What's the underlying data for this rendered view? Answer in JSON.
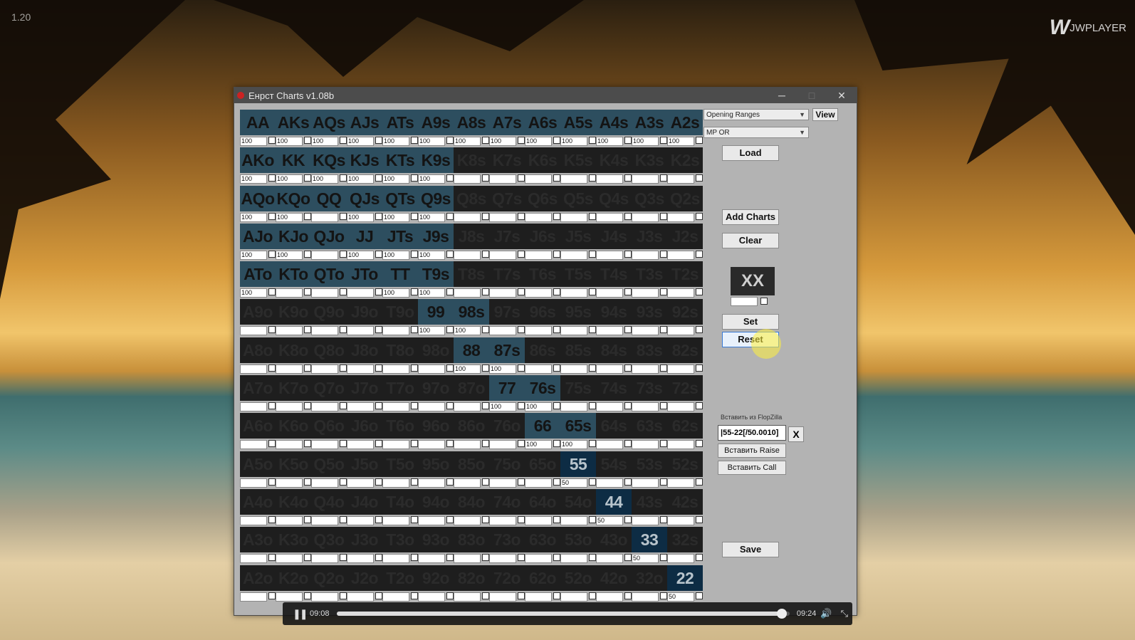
{
  "video": {
    "top_time": "1.20",
    "logo": "JWPLAYER",
    "current_time": "09:08",
    "duration": "09:24",
    "progress": 0.983
  },
  "window": {
    "title": "Енрст Charts v1.08b",
    "min": "─",
    "max": "□",
    "close": "✕"
  },
  "grid": {
    "rows": [
      [
        "AA",
        "AKs",
        "AQs",
        "AJs",
        "ATs",
        "A9s",
        "A8s",
        "A7s",
        "A6s",
        "A5s",
        "A4s",
        "A3s",
        "A2s"
      ],
      [
        "AKo",
        "KK",
        "KQs",
        "KJs",
        "KTs",
        "K9s",
        "K8s",
        "K7s",
        "K6s",
        "K5s",
        "K4s",
        "K3s",
        "K2s"
      ],
      [
        "AQo",
        "KQo",
        "QQ",
        "QJs",
        "QTs",
        "Q9s",
        "Q8s",
        "Q7s",
        "Q6s",
        "Q5s",
        "Q4s",
        "Q3s",
        "Q2s"
      ],
      [
        "AJo",
        "KJo",
        "QJo",
        "JJ",
        "JTs",
        "J9s",
        "J8s",
        "J7s",
        "J6s",
        "J5s",
        "J4s",
        "J3s",
        "J2s"
      ],
      [
        "ATo",
        "KTo",
        "QTo",
        "JTo",
        "TT",
        "T9s",
        "T8s",
        "T7s",
        "T6s",
        "T5s",
        "T4s",
        "T3s",
        "T2s"
      ],
      [
        "A9o",
        "K9o",
        "Q9o",
        "J9o",
        "T9o",
        "99",
        "98s",
        "97s",
        "96s",
        "95s",
        "94s",
        "93s",
        "92s"
      ],
      [
        "A8o",
        "K8o",
        "Q8o",
        "J8o",
        "T8o",
        "98o",
        "88",
        "87s",
        "86s",
        "85s",
        "84s",
        "83s",
        "82s"
      ],
      [
        "A7o",
        "K7o",
        "Q7o",
        "J7o",
        "T7o",
        "97o",
        "87o",
        "77",
        "76s",
        "75s",
        "74s",
        "73s",
        "72s"
      ],
      [
        "A6o",
        "K6o",
        "Q6o",
        "J6o",
        "T6o",
        "96o",
        "86o",
        "76o",
        "66",
        "65s",
        "64s",
        "63s",
        "62s"
      ],
      [
        "A5o",
        "K5o",
        "Q5o",
        "J5o",
        "T5o",
        "95o",
        "85o",
        "75o",
        "65o",
        "55",
        "54s",
        "53s",
        "52s"
      ],
      [
        "A4o",
        "K4o",
        "Q4o",
        "J4o",
        "T4o",
        "94o",
        "84o",
        "74o",
        "64o",
        "54o",
        "44",
        "43s",
        "42s"
      ],
      [
        "A3o",
        "K3o",
        "Q3o",
        "J3o",
        "T3o",
        "93o",
        "83o",
        "73o",
        "63o",
        "53o",
        "43o",
        "33",
        "32s"
      ],
      [
        "A2o",
        "K2o",
        "Q2o",
        "J2o",
        "T2o",
        "92o",
        "82o",
        "72o",
        "62o",
        "52o",
        "42o",
        "32o",
        "22"
      ]
    ],
    "percents": {
      "AA": "100",
      "AKs": "100",
      "AQs": "100",
      "AJs": "100",
      "ATs": "100",
      "A9s": "100",
      "A8s": "100",
      "A7s": "100",
      "A6s": "100",
      "A5s": "100",
      "A4s": "100",
      "A3s": "100",
      "A2s": "100",
      "AKo": "100",
      "KK": "100",
      "KQs": "100",
      "KJs": "100",
      "KTs": "100",
      "K9s": "100",
      "AQo": "100",
      "KQo": "100",
      "QJs": "100",
      "QTs": "100",
      "Q9s": "100",
      "AJo": "100",
      "KJo": "100",
      "JJ": "100",
      "JTs": "100",
      "J9s": "100",
      "ATo": "100",
      "TT": "100",
      "T9s": "100",
      "99": "100",
      "98s": "100",
      "88": "100",
      "87s": "100",
      "77": "100",
      "76s": "100",
      "66": "100",
      "65s": "100",
      "55": "50",
      "44": "50",
      "33": "50",
      "22": "50"
    },
    "selected": [
      "AA",
      "AKs",
      "AQs",
      "AJs",
      "ATs",
      "A9s",
      "A8s",
      "A7s",
      "A6s",
      "A5s",
      "A4s",
      "A3s",
      "A2s",
      "AKo",
      "KK",
      "KQs",
      "KJs",
      "KTs",
      "K9s",
      "AQo",
      "KQo",
      "QQ",
      "QJs",
      "QTs",
      "Q9s",
      "AJo",
      "KJo",
      "QJo",
      "JJ",
      "JTs",
      "J9s",
      "ATo",
      "KTo",
      "QTo",
      "JTo",
      "TT",
      "T9s",
      "99",
      "98s",
      "88",
      "87s",
      "77",
      "76s",
      "66",
      "65s"
    ],
    "partial": [
      "55",
      "44",
      "33",
      "22"
    ]
  },
  "sidebar": {
    "range_type": "Opening Ranges",
    "view_label": "View",
    "position": "MP OR",
    "load_label": "Load",
    "add_charts_label": "Add Charts",
    "clear_label": "Clear",
    "xx_label": "XX",
    "set_label": "Set",
    "reset_label": "Reset",
    "flopzilla_label": "Вставить из FlopZilla",
    "flopzilla_value": "|55-22[/50.0010]",
    "x_label": "X",
    "insert_raise_label": "Вставить Raise",
    "insert_call_label": "Вставить Call",
    "save_label": "Save"
  }
}
